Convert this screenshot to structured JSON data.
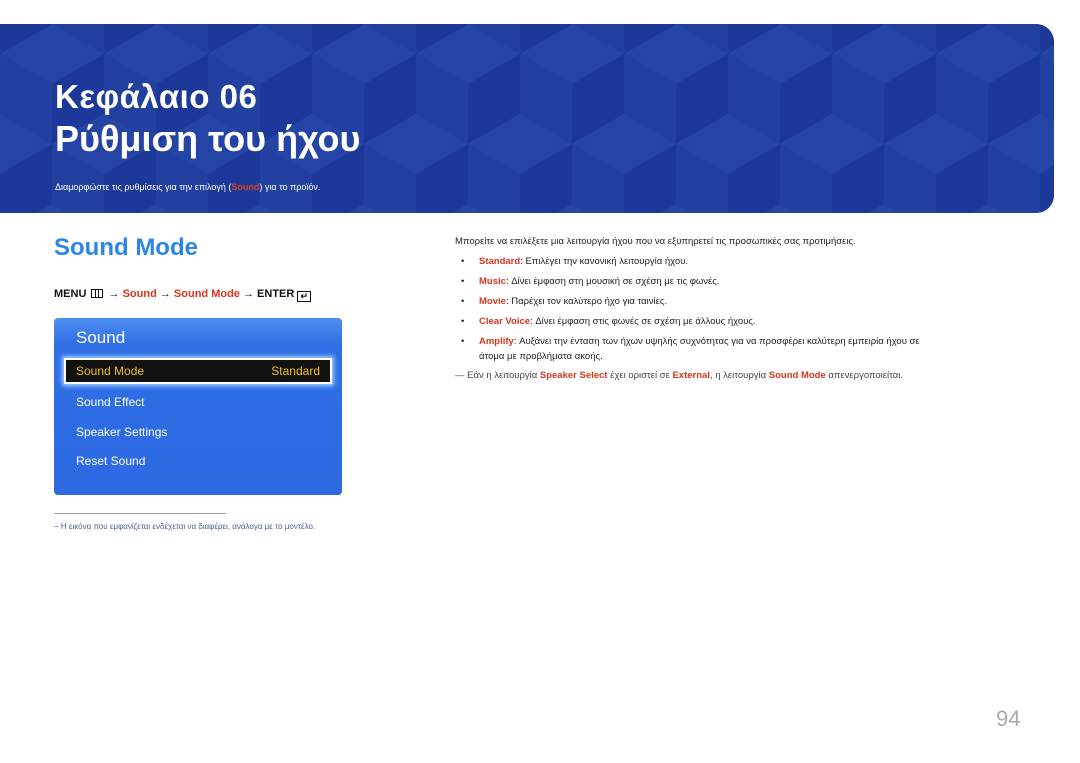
{
  "banner": {
    "chapter": "Κεφάλαιο 06",
    "title": "Ρύθμιση του ήχου",
    "description_before": "Διαμορφώστε τις ρυθμίσεις για την επιλογή (",
    "description_highlight": "Sound",
    "description_after": ") για το προϊόν.",
    "background_color": "#1f3d9e"
  },
  "section": {
    "title": "Sound Mode",
    "menu_path": {
      "menu": "MENU",
      "menu_icon": "menu-icon",
      "arrow": "→",
      "step1": "Sound",
      "step2": "Sound Mode",
      "enter": "ENTER",
      "enter_icon": "enter-icon"
    }
  },
  "osd": {
    "title": "Sound",
    "selected": {
      "label": "Sound Mode",
      "value": "Standard"
    },
    "items": [
      "Sound Effect",
      "Speaker Settings",
      "Reset Sound"
    ]
  },
  "footnote": "−  Η εικόνα που εμφανίζεται ενδέχεται να διαφέρει, ανάλογα με το μοντέλο.",
  "description": {
    "intro": "Μπορείτε να επιλέξετε μια λειτουργία ήχου που να εξυπηρετεί τις προσωπικές σας προτιμήσεις.",
    "bullets": [
      {
        "term": "Standard",
        "text": ": Επιλέγει την κανονική λειτουργία ήχου."
      },
      {
        "term": "Music",
        "text": ": Δίνει έμφαση στη μουσική σε σχέση με τις φωνές."
      },
      {
        "term": "Movie",
        "text": ": Παρέχει τον καλύτερο ήχο για ταινίες."
      },
      {
        "term": "Clear Voice",
        "text": ": Δίνει έμφαση στις φωνές σε σχέση με άλλους ήχους."
      },
      {
        "term": "Amplify",
        "text": ": Αυξάνει την ένταση των ήχων υψηλής συχνότητας για να προσφέρει καλύτερη εμπειρία ήχου σε",
        "text2": "άτομα με προβλήματα ακοής."
      }
    ],
    "note": {
      "dash": "—",
      "part1": " Εάν η λειτουργία ",
      "term1": "Speaker Select",
      "part2": " έχει οριστεί σε ",
      "term2": "External",
      "part3": ", η λειτουργία ",
      "term3": "Sound Mode",
      "part4": " απενεργοποιείται."
    }
  },
  "page_number": "94",
  "colors": {
    "accent_red": "#d6351c",
    "heading_blue": "#2b86e6",
    "osd_highlight": "#f0c020"
  }
}
